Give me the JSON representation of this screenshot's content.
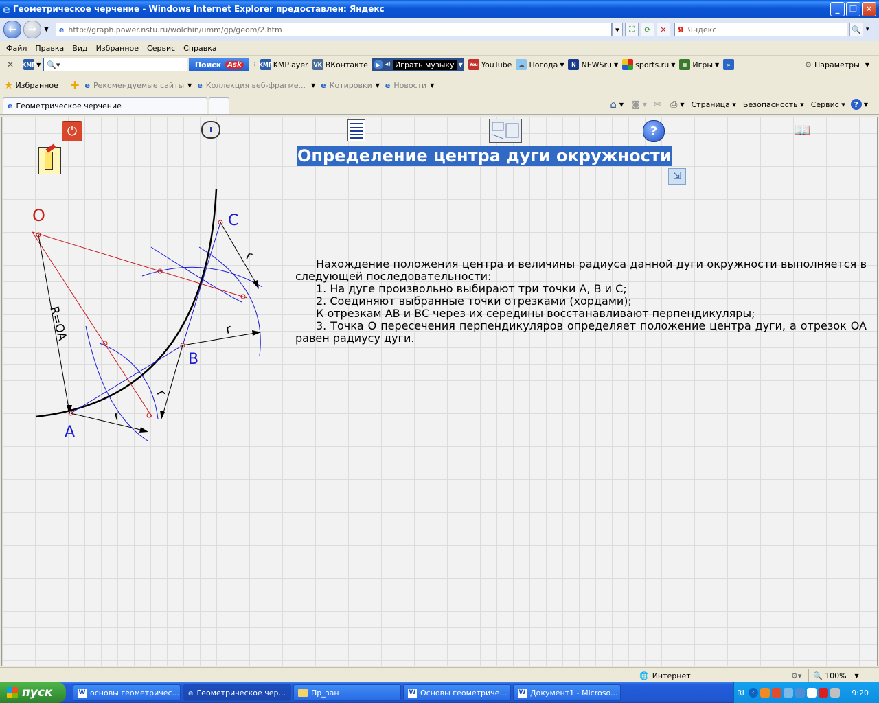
{
  "window": {
    "title": "Геометрическое черчение - Windows Internet Explorer предоставлен: Яндекс"
  },
  "address": {
    "url": "http://graph.power.nstu.ru/wolchin/umm/gp/geom/2.htm",
    "search_placeholder": "Яндекс"
  },
  "menu": [
    "Файл",
    "Правка",
    "Вид",
    "Избранное",
    "Сервис",
    "Справка"
  ],
  "toolbar": {
    "search_button": "Поиск",
    "items": [
      "KMPlayer",
      "ВКонтакте",
      "YouTube",
      "Погода",
      "NEWSru",
      "sports.ru",
      "Игры"
    ],
    "music_label": "Играть музыку",
    "params_label": "Параметры"
  },
  "favorites": {
    "label": "Избранное",
    "links": [
      "Рекомендуемые сайты",
      "Коллекция веб-фрагме...",
      "Котировки",
      "Новости"
    ]
  },
  "tab": {
    "title": "Геометрическое черчение",
    "commands": [
      "Страница",
      "Безопасность",
      "Сервис"
    ]
  },
  "content": {
    "heading": "Определение центра дуги окружности",
    "paragraphs": [
      "Нахождение положения центра и величины радиуса данной дуги окружности выполняется в следующей последовательности:",
      "1. На дуге произвольно  выбирают три точки A, B и C;",
      "2. Соединяют выбранные точки отрезками (хордами);",
      "К отрезкам AB и BC через их середины восстанавливают перпендикуляры;",
      "3. Точка O пересечения перпендикуляров определяет положение центра дуги, а отрезок OA равен радиусу дуги."
    ],
    "drawing": {
      "label_o": "O",
      "label_a": "A",
      "label_b": "B",
      "label_c": "C",
      "label_r": "r",
      "label_roa": "R=OA"
    }
  },
  "status": {
    "zone": "Интернет",
    "zoom": "100%"
  },
  "taskbar": {
    "start": "пуск",
    "tasks": [
      "основы геометричес...",
      "Геометрическое чер...",
      "Пр_зан",
      "Основы геометриче...",
      "Документ1 - Microso..."
    ],
    "lang": "RL",
    "clock": "9:20"
  }
}
